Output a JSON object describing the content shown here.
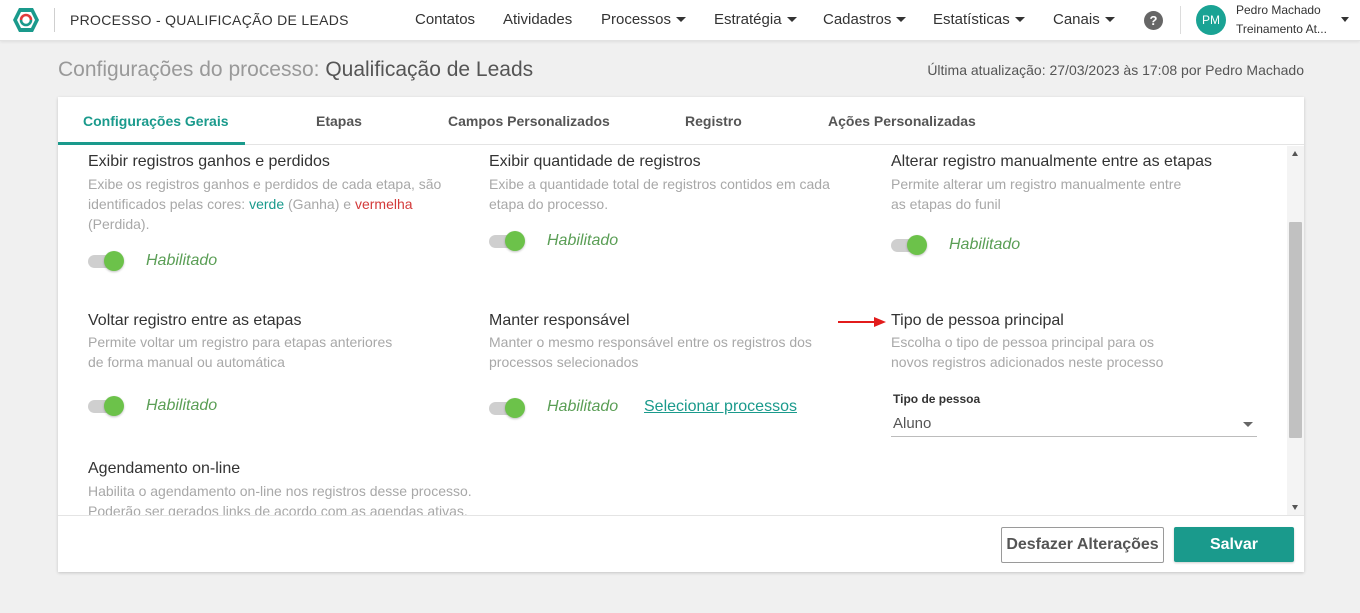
{
  "header": {
    "app_title": "PROCESSO - QUALIFICAÇÃO DE LEADS",
    "nav": [
      {
        "label": "Contatos"
      },
      {
        "label": "Atividades"
      },
      {
        "label": "Processos"
      },
      {
        "label": "Estratégia"
      },
      {
        "label": "Cadastros"
      },
      {
        "label": "Estatísticas"
      },
      {
        "label": "Canais"
      }
    ],
    "help": "?",
    "user": {
      "initials": "PM",
      "name": "Pedro Machado",
      "team": "Treinamento At..."
    }
  },
  "page": {
    "title_prefix": "Configurações do processo: ",
    "title_name": "Qualificação de Leads",
    "last_update": "Última atualização: 27/03/2023 às 17:08 por Pedro Machado"
  },
  "tabs": [
    {
      "label": "Configurações Gerais",
      "active": true
    },
    {
      "label": "Etapas"
    },
    {
      "label": "Campos Personalizados"
    },
    {
      "label": "Registro"
    },
    {
      "label": "Ações Personalizadas"
    }
  ],
  "settings": {
    "ganhos": {
      "title": "Exibir registros ganhos e perdidos",
      "desc_1": "Exibe os registros ganhos e perdidos de cada etapa, são identificados pelas cores: ",
      "desc_green": "verde",
      "desc_2": " (Ganha) e ",
      "desc_red": "vermelha",
      "desc_3": " (Perdida).",
      "status": "Habilitado"
    },
    "quantidade": {
      "title": "Exibir quantidade de registros",
      "desc": "Exibe a quantidade total de registros contidos em cada etapa do processo.",
      "status": "Habilitado"
    },
    "alterar": {
      "title": "Alterar registro manualmente entre as etapas",
      "desc_1": "Permite alterar um registro manualmente entre",
      "desc_2": "as etapas do funil",
      "status": "Habilitado"
    },
    "voltar": {
      "title": "Voltar registro entre as etapas",
      "desc_1": "Permite voltar um registro para etapas anteriores",
      "desc_2": "de forma manual ou automática",
      "status": "Habilitado"
    },
    "responsavel": {
      "title": "Manter responsável",
      "desc_1": "Manter o mesmo responsável entre os registros dos",
      "desc_2": "processos selecionados",
      "status": "Habilitado",
      "link": "Selecionar processos"
    },
    "tipo_pessoa": {
      "title": "Tipo de pessoa principal",
      "desc_1": "Escolha o tipo de pessoa principal para os",
      "desc_2": "novos registros adicionados neste processo",
      "select_label": "Tipo de pessoa",
      "select_value": "Aluno"
    },
    "agendamento": {
      "title": "Agendamento on-line",
      "desc_1": "Habilita o agendamento on-line nos registros desse processo.",
      "desc_2": "Poderão ser gerados links de acordo com as agendas ativas."
    }
  },
  "footer": {
    "undo_label": "Desfazer Alterações",
    "save_label": "Salvar"
  },
  "colors": {
    "accent": "#1a9a8c",
    "toggle_on": "#6cc24a",
    "enabled_text": "#5a9e55",
    "arrow": "#e21b1b"
  }
}
